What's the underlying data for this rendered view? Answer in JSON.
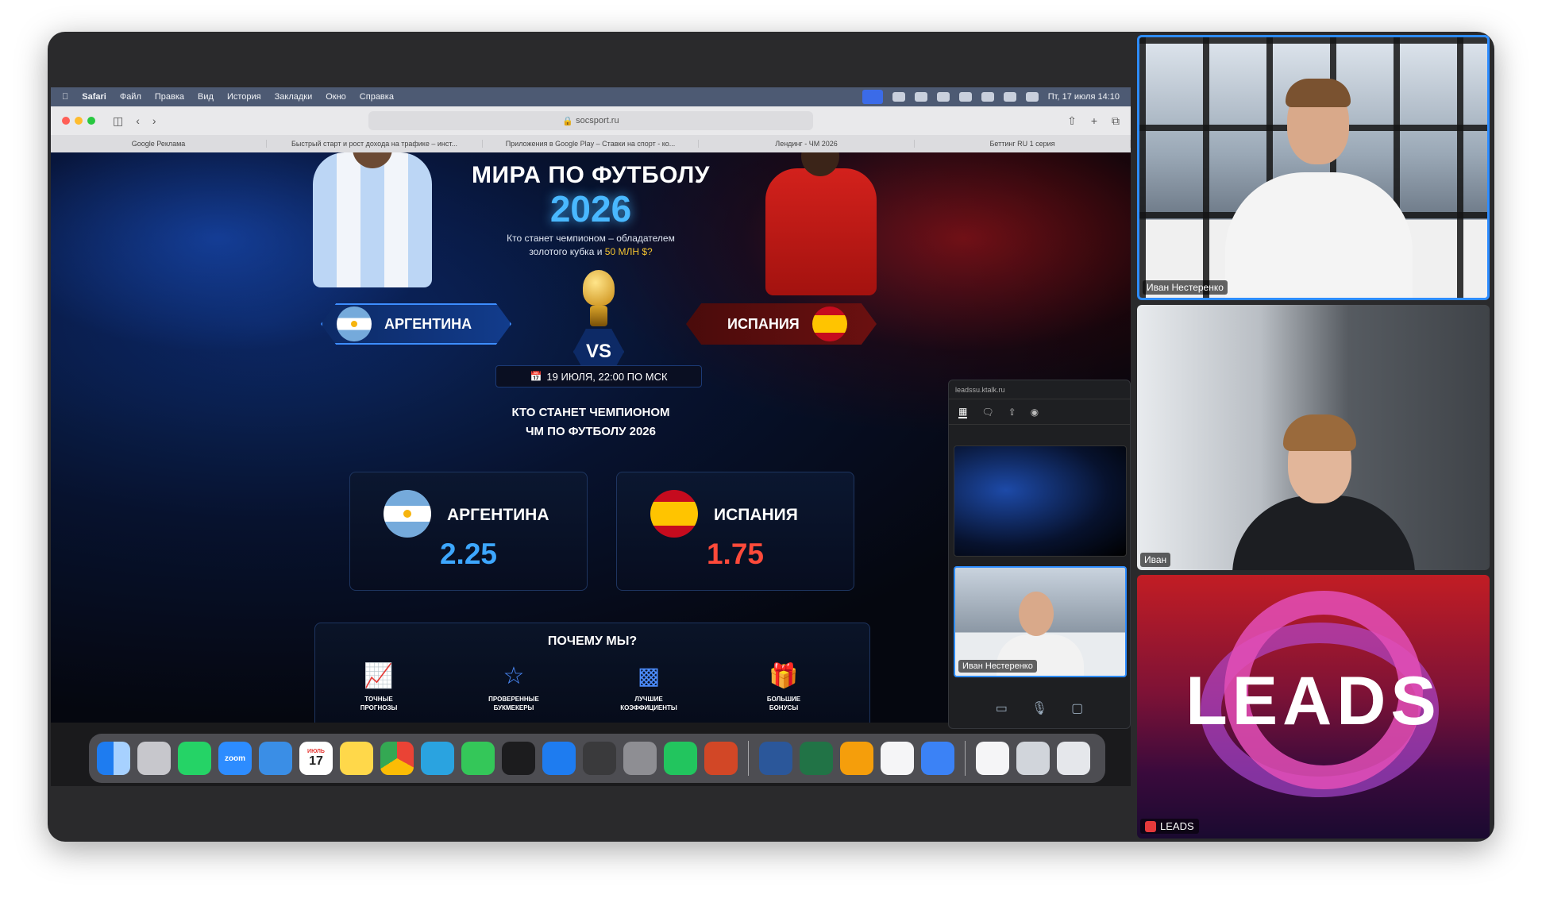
{
  "menubar": {
    "items": [
      "Safari",
      "Файл",
      "Правка",
      "Вид",
      "История",
      "Закладки",
      "Окно",
      "Справка"
    ],
    "datetime": "Пт, 17 июля 14:10"
  },
  "browser": {
    "url": "socsport.ru",
    "tabs": [
      "Google Реклама",
      "Быстрый старт и рост дохода на трафике – инст...",
      "Приложения в Google Play – Ставки на спорт - ко...",
      "Лендинг - ЧМ 2026",
      "Беттинг RU 1 серия"
    ]
  },
  "page": {
    "title": "МИРА ПО ФУТБОЛУ",
    "year": "2026",
    "subtitle_1": "Кто станет чемпионом – обладателем",
    "subtitle_2": "золотого кубка и",
    "subtitle_highlight": "50 МЛН $?",
    "team_left": "АРГЕНТИНА",
    "team_right": "ИСПАНИЯ",
    "vs": "VS",
    "date": "19 ИЮЛЯ, 22:00 ПО МСК",
    "question_1": "КТО СТАНЕТ ЧЕМПИОНОМ",
    "question_2": "ЧМ ПО ФУТБОЛУ 2026",
    "odds": [
      {
        "team": "АРГЕНТИНА",
        "value": "2.25"
      },
      {
        "team": "ИСПАНИЯ",
        "value": "1.75"
      }
    ],
    "why_title": "ПОЧЕМУ МЫ?",
    "why_items": [
      {
        "line1": "ТОЧНЫЕ",
        "line2": "ПРОГНОЗЫ"
      },
      {
        "line1": "ПРОВЕРЕННЫЕ",
        "line2": "БУКМЕКЕРЫ"
      },
      {
        "line1": "ЛУЧШИЕ",
        "line2": "КОЭФФИЦИЕНТЫ"
      },
      {
        "line1": "БОЛЬШИЕ",
        "line2": "БОНУСЫ"
      }
    ]
  },
  "mini_panel": {
    "url": "leadssu.ktalk.ru",
    "presenter_name": "Иван Нестеренко"
  },
  "participants": [
    {
      "name": "Иван Нестеренко"
    },
    {
      "name": "Иван"
    },
    {
      "name": "LEADS"
    }
  ],
  "leads_logo": "LEADS",
  "dock": {
    "zoom_label": "zoom",
    "calendar_month": "ИЮЛЬ",
    "calendar_day": "17"
  },
  "colors": {
    "accent_blue": "#3da7ff",
    "accent_red": "#ff4a3a",
    "active_speaker_border": "#2d8cff"
  }
}
